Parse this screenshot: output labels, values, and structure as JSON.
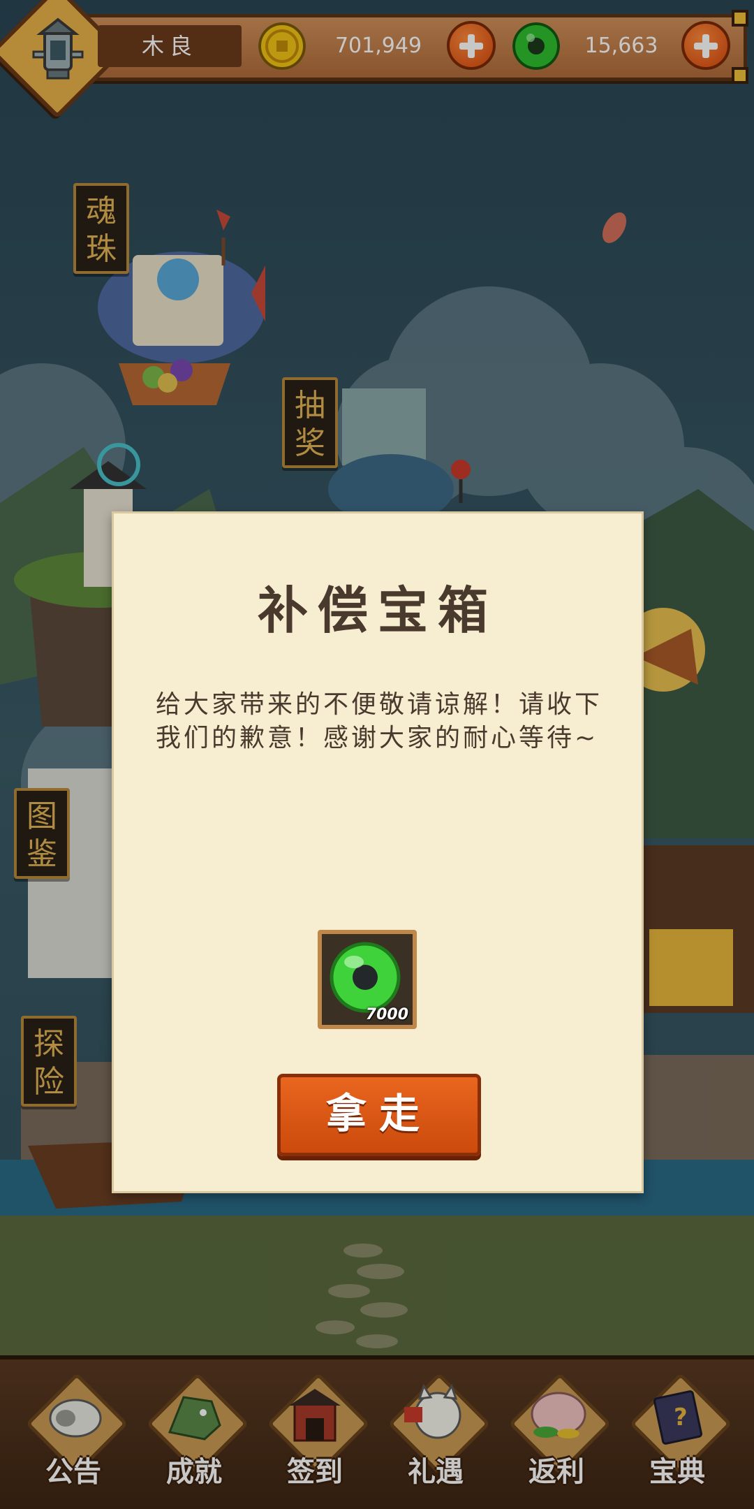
{
  "player": {
    "name": "木良"
  },
  "currencies": {
    "gold": {
      "value": "701,949",
      "icon": "gold-coin-icon"
    },
    "jade": {
      "value": "15,663",
      "icon": "jade-ring-icon"
    }
  },
  "side_signs": [
    "魂珠",
    "抽奖",
    "图鉴",
    "探险"
  ],
  "dialog": {
    "title": "补偿宝箱",
    "message": "给大家带来的不便敬请谅解！请收下我们的歉意！感谢大家的耐心等待~",
    "reward": {
      "icon": "jade-ring-icon",
      "amount": "7000"
    },
    "button_label": "拿走"
  },
  "bottom_nav": [
    {
      "label": "公告",
      "icon": "conch-horn-icon"
    },
    {
      "label": "成就",
      "icon": "dragon-head-icon"
    },
    {
      "label": "签到",
      "icon": "gate-icon"
    },
    {
      "label": "礼遇",
      "icon": "lucky-cat-icon"
    },
    {
      "label": "返利",
      "icon": "piggy-bank-icon"
    },
    {
      "label": "宝典",
      "icon": "book-icon"
    }
  ],
  "colors": {
    "accent_orange": "#d8520f",
    "parchment": "#f7eed2",
    "wood": "#b06c3a",
    "sky": "#2c4a57"
  }
}
